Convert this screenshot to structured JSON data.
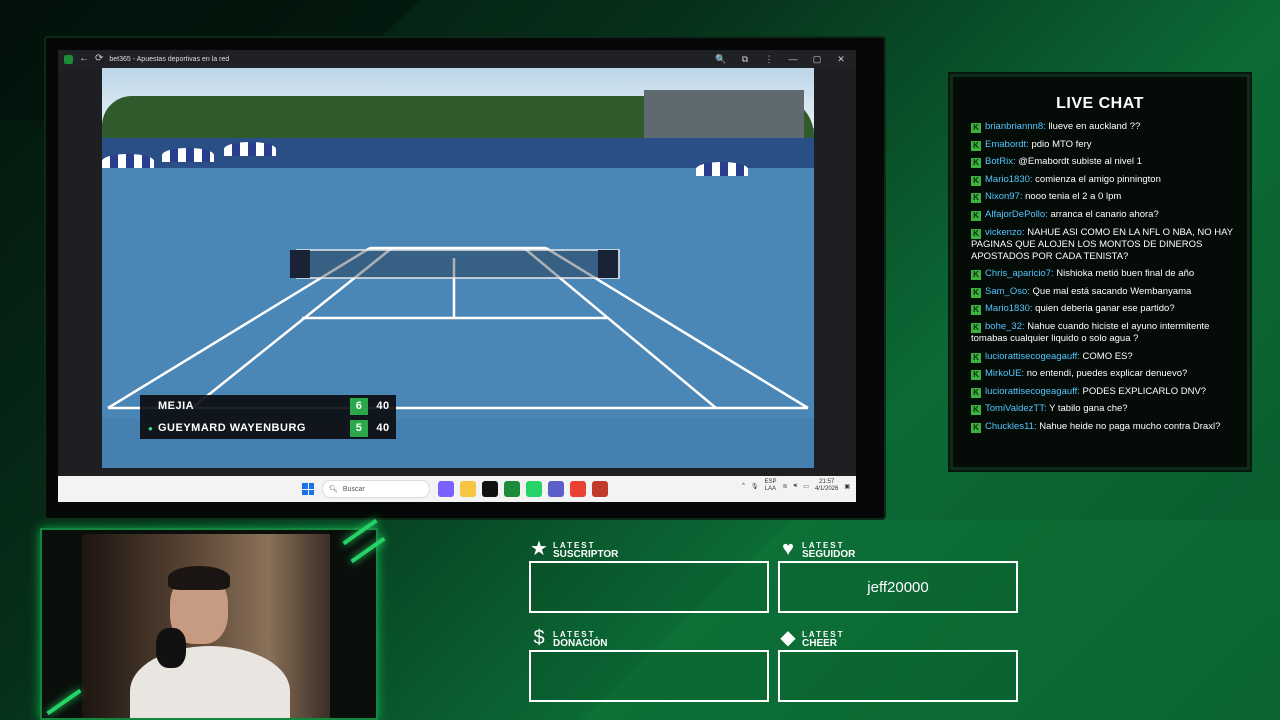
{
  "browser": {
    "tab_title": "bet365 - Apuestas deportivas en la red",
    "nav_back": "←",
    "nav_reload": "⟳",
    "controls": [
      "🔍",
      "⧉",
      "⋮",
      "—",
      "▢",
      "✕"
    ]
  },
  "scoreboard": {
    "rows": [
      {
        "name": "MEJIA",
        "sets": "6",
        "points": "40",
        "serving": false
      },
      {
        "name": "GUEYMARD WAYENBURG",
        "sets": "5",
        "points": "40",
        "serving": true
      }
    ],
    "serve_marker": "●"
  },
  "taskbar": {
    "search_placeholder": "Buscar",
    "language_top": "ESP",
    "language_bottom": "LAA",
    "time": "21:57",
    "date": "4/1/2026"
  },
  "chat": {
    "title": "LIVE CHAT",
    "badge": "K",
    "messages": [
      {
        "user": "brianbriannn8",
        "text": "llueve en auckland ??"
      },
      {
        "user": "Emabordt",
        "text": "pdio MTO fery"
      },
      {
        "user": "BotRix",
        "text": "@Emabordt subiste al nivel 1"
      },
      {
        "user": "Mario1830",
        "text": "comienza el amigo pinnington"
      },
      {
        "user": "Nixon97",
        "text": "nooo tenia el 2 a 0 lpm"
      },
      {
        "user": "AlfajorDePollo",
        "text": "arranca el canario ahora?"
      },
      {
        "user": "vickenzo",
        "text": "NAHUE ASI COMO EN LA NFL O NBA, NO HAY PAGINAS QUE ALOJEN LOS MONTOS DE DINEROS APOSTADOS POR CADA TENISTA?"
      },
      {
        "user": "Chris_aparicio7",
        "text": "Nishioka metió buen final de año"
      },
      {
        "user": "Sam_Oso",
        "text": "Que mal está sacando Wembanyama"
      },
      {
        "user": "Mario1830",
        "text": "quien deberia ganar ese partido?"
      },
      {
        "user": "bohe_32",
        "text": "Nahue cuando hiciste el ayuno intermitente tomabas cualquier liquido o solo agua ?"
      },
      {
        "user": "luciorattisecogeagauff",
        "text": "COMO ES?"
      },
      {
        "user": "MirkoUE",
        "text": "no entendi, puedes explicar denuevo?"
      },
      {
        "user": "luciorattisecogeagauff",
        "text": "PODES EXPLICARLO DNV?"
      },
      {
        "user": "TomiValdezTT",
        "text": "Y tabilo gana che?"
      },
      {
        "user": "Chuckles11",
        "text": "Nahue heide no paga mucho contra Draxl?"
      }
    ]
  },
  "widgets": {
    "suscriptor": {
      "icon": "★",
      "label_top": "LATEST",
      "label_bottom": "SUSCRIPTOR",
      "value": ""
    },
    "seguidor": {
      "icon": "♥",
      "label_top": "LATEST",
      "label_bottom": "SEGUIDOR",
      "value": "jeff20000"
    },
    "donacion": {
      "icon": "$",
      "label_top": "LATEST",
      "label_bottom": "DONACIÓN",
      "value": ""
    },
    "cheer": {
      "icon": "◆",
      "label_top": "LATEST",
      "label_bottom": "CHEER",
      "value": ""
    }
  },
  "colors": {
    "accent_green": "#25d366",
    "chat_user": "#52c6ff",
    "score_set": "#2aa84a",
    "court_blue": "#4a86b6"
  }
}
